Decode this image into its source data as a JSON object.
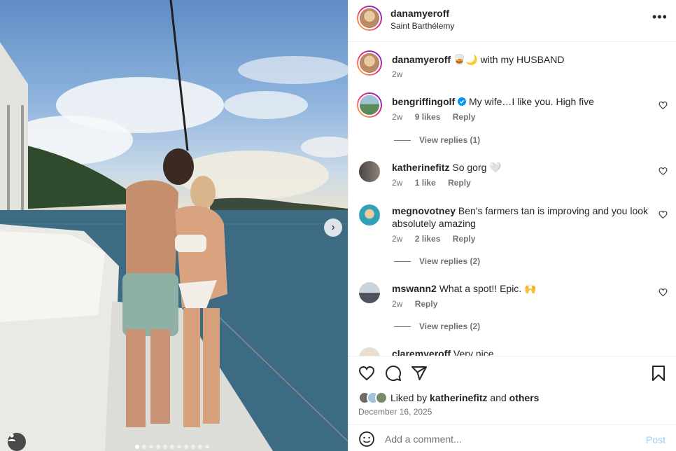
{
  "post": {
    "author": "danamyeroff",
    "location": "Saint Barthélemy",
    "caption_user": "danamyeroff",
    "caption_text": "🥃🌙 with my HUSBAND",
    "caption_time": "2w",
    "more_label": "•••"
  },
  "comments": [
    {
      "user": "bengriffingolf",
      "verified": true,
      "text": "My wife…I like you. High five",
      "time": "2w",
      "likes": "9 likes",
      "reply": "Reply",
      "view_replies": "View replies (1)",
      "avatar_color": "#7b9fb0"
    },
    {
      "user": "katherinefitz",
      "verified": false,
      "text": "So gorg 🤍",
      "time": "2w",
      "likes": "1 like",
      "reply": "Reply",
      "view_replies": "",
      "avatar_color": "#6f6a66"
    },
    {
      "user": "megnovotney",
      "verified": false,
      "text": "Ben's farmers tan is improving and you look absolutely amazing",
      "time": "2w",
      "likes": "2 likes",
      "reply": "Reply",
      "view_replies": "View replies (2)",
      "avatar_color": "#3aa6b8"
    },
    {
      "user": "mswann2",
      "verified": false,
      "text": "What a spot!! Epic. 🙌",
      "time": "2w",
      "likes": "",
      "reply": "Reply",
      "view_replies": "View replies (2)",
      "avatar_color": "#8a8f95"
    },
    {
      "user": "claremyeroff",
      "verified": false,
      "text": "Very nice",
      "time": "",
      "likes": "",
      "reply": "",
      "view_replies": "",
      "avatar_color": "#d8c4b0"
    }
  ],
  "actions": {
    "liked_by_prefix": "Liked by",
    "liked_by_user": "katherinefitz",
    "liked_by_and": "and",
    "liked_by_others": "others",
    "date": "December 16, 2025"
  },
  "composer": {
    "placeholder": "Add a comment...",
    "post_label": "Post"
  },
  "colors": {
    "link_blue": "#0095f6",
    "post_disabled": "#9fc9f5",
    "secondary_text": "#737373",
    "verified": "#0095f6"
  },
  "icons": [
    "heart-icon",
    "comment-icon",
    "share-icon",
    "bookmark-icon",
    "emoji-icon",
    "user-tag-icon",
    "chevron-right-icon",
    "more-icon",
    "verified-icon"
  ],
  "carousel": {
    "total": 11,
    "active": 1,
    "next_label": "›"
  }
}
